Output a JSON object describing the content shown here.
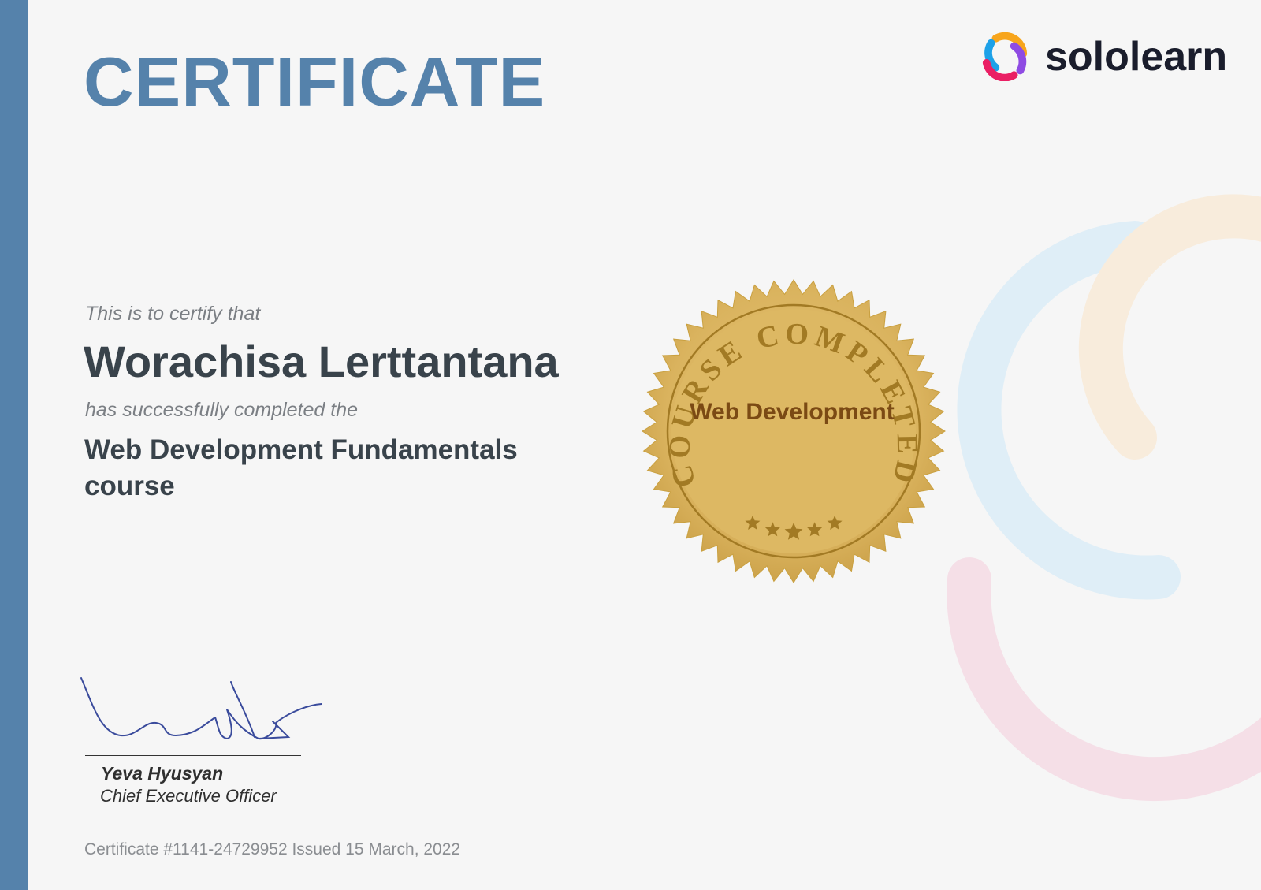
{
  "certificate": {
    "heading": "CERTIFICATE",
    "certify_text": "This is to certify that",
    "recipient_name": "Worachisa Lerttantana",
    "completed_text": "has successfully completed the",
    "course_name": "Web Development Fundamentals course",
    "certificate_info": "Certificate #1141-24729952 Issued 15 March, 2022"
  },
  "brand": {
    "name": "sololearn",
    "logo_icon": "sololearn-logo-icon",
    "colors": {
      "primary_blue": "#5582ab",
      "logo_orange": "#f7a51c",
      "logo_blue": "#1da1e8",
      "logo_pink": "#ea1f64",
      "logo_purple": "#8f4be3"
    }
  },
  "seal": {
    "ring_text": "COURSE COMPLETED",
    "center_text": "Web Development",
    "star_count": 5,
    "colors": {
      "gold": "#dcb864",
      "dark_gold": "#a27a24",
      "text_brown": "#7b4a14"
    }
  },
  "signatory": {
    "name": "Yeva Hyusyan",
    "title": "Chief Executive Officer"
  }
}
